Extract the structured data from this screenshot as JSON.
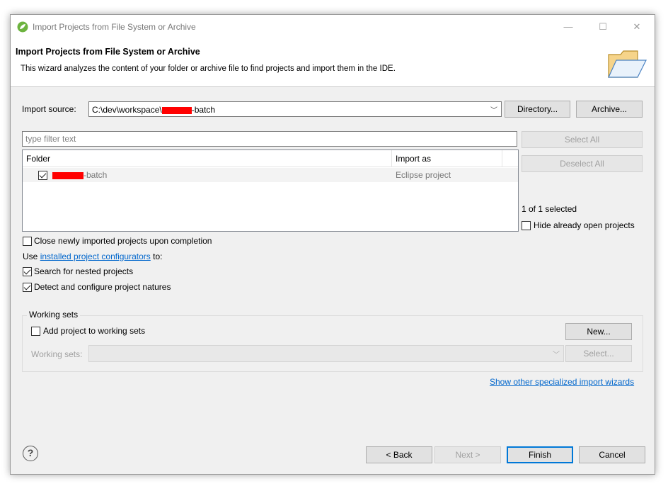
{
  "window": {
    "title": "Import Projects from File System or Archive",
    "minimize": "—",
    "maximize": "☐",
    "close": "✕"
  },
  "header": {
    "title": "Import Projects from File System or Archive",
    "description": "This wizard analyzes the content of your folder or archive file to find projects and import them in the IDE."
  },
  "source": {
    "label": "Import source:",
    "value_prefix": "C:\\dev\\workspace\\",
    "value_suffix": "-batch",
    "directory_button": "Directory...",
    "archive_button": "Archive..."
  },
  "filter": {
    "placeholder": "type filter text"
  },
  "table": {
    "columns": [
      "Folder",
      "Import as"
    ],
    "rows": [
      {
        "folder_suffix": "-batch",
        "import_as": "Eclipse project",
        "checked": true
      }
    ]
  },
  "side": {
    "select_all": "Select All",
    "deselect_all": "Deselect All",
    "selection_count": "1 of 1 selected",
    "hide_open": "Hide already open projects"
  },
  "options": {
    "close_imported": "Close newly imported projects upon completion",
    "use_prefix": "Use",
    "configurators_link": "installed project configurators",
    "use_suffix": "to:",
    "search_nested": "Search for nested projects",
    "detect_configure": "Detect and configure project natures"
  },
  "working_sets": {
    "legend": "Working sets",
    "add_label": "Add project to working sets",
    "new_button": "New...",
    "sets_label": "Working sets:",
    "select_button": "Select..."
  },
  "other_wizards_link": "Show other specialized import wizards",
  "footer": {
    "help": "?",
    "back": "< Back",
    "next": "Next >",
    "finish": "Finish",
    "cancel": "Cancel"
  },
  "colors": {
    "accent": "#0078d7",
    "link": "#0066cc",
    "redaction": "#ff0000"
  },
  "icons": {
    "app": "spring-leaf-icon",
    "header": "open-folder-icon",
    "help": "help-icon"
  }
}
